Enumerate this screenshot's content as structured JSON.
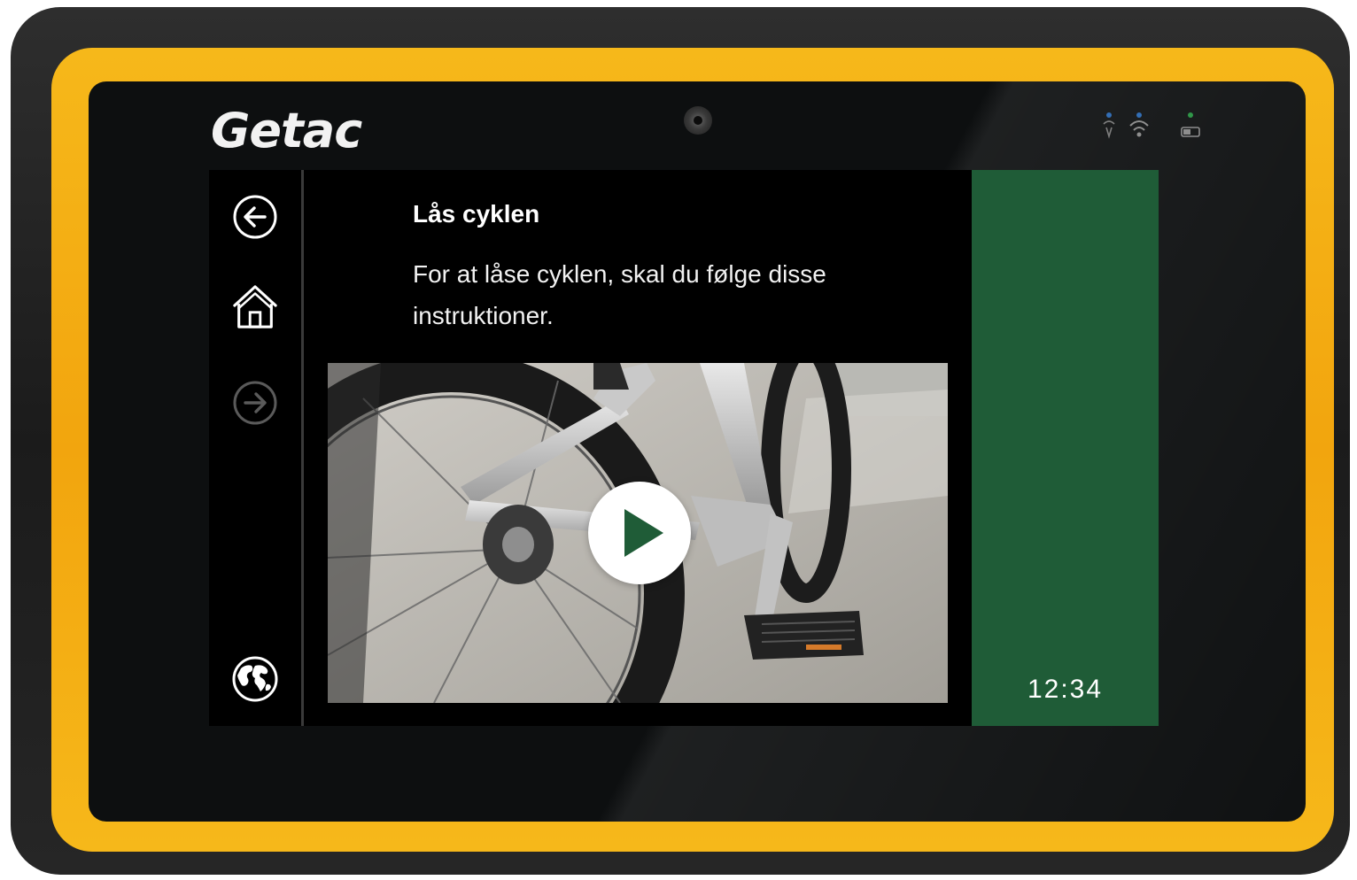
{
  "device": {
    "brand": "Getac"
  },
  "sidebar": {
    "back_icon": "arrow-left-circle-icon",
    "home_icon": "home-icon",
    "forward_icon": "arrow-right-circle-icon",
    "language_icon": "globe-icon"
  },
  "content": {
    "title": "Lås cyklen",
    "instruction": "For at låse cyklen, skal du følge disse instruktioner.",
    "video": {
      "play_icon": "play-icon"
    }
  },
  "status_panel": {
    "time": "12:34"
  },
  "colors": {
    "accent_green": "#1f5c37",
    "play_triangle": "#1f5c37",
    "screen_bg": "#000000",
    "bumper_yellow": "#f4ad14"
  }
}
